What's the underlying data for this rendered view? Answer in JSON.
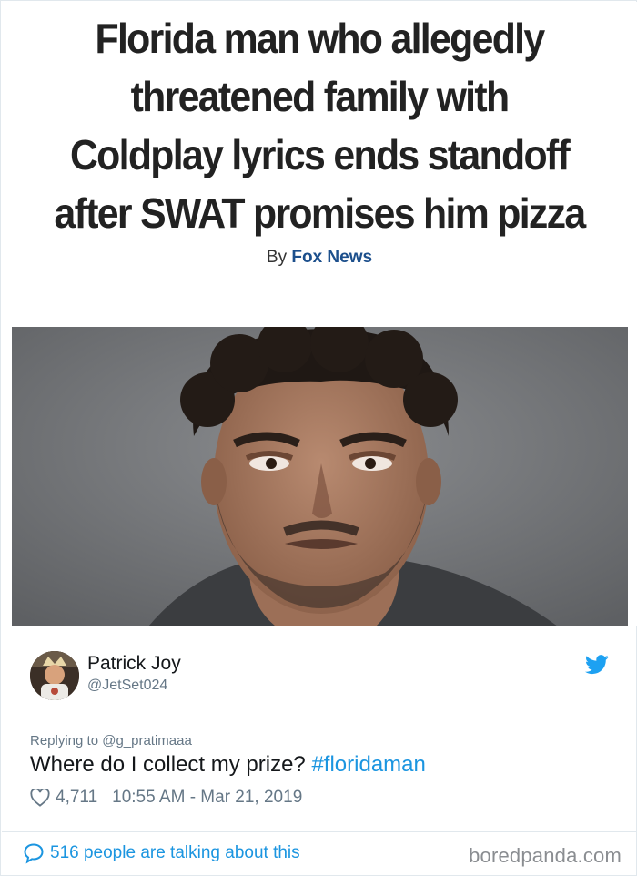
{
  "article": {
    "headline": "Florida man who allegedly\nthreatened family with\nColdplay lyrics ends standoff\nafter SWAT promises him pizza",
    "byline_prefix": "By",
    "byline_source": "Fox News"
  },
  "tweet": {
    "author_name": "Patrick Joy",
    "author_handle": "@JetSet024",
    "reply_prefix": "Replying to",
    "reply_to": "@g_pratimaaa",
    "text": "Where do I collect my prize?",
    "hashtag": "#floridaman",
    "likes": "4,711",
    "timestamp": "10:55 AM - Mar 21, 2019",
    "talking": "516 people are talking about this"
  },
  "watermark": "boredpanda.com",
  "icons": {
    "brand": "twitter-bird-icon",
    "like": "heart-icon",
    "talking": "comment-bubble-icon"
  },
  "colors": {
    "link": "#1b95e0",
    "secondary_text": "#657786",
    "fox_blue": "#1c4f8c",
    "photo_background": "#6f7175"
  }
}
